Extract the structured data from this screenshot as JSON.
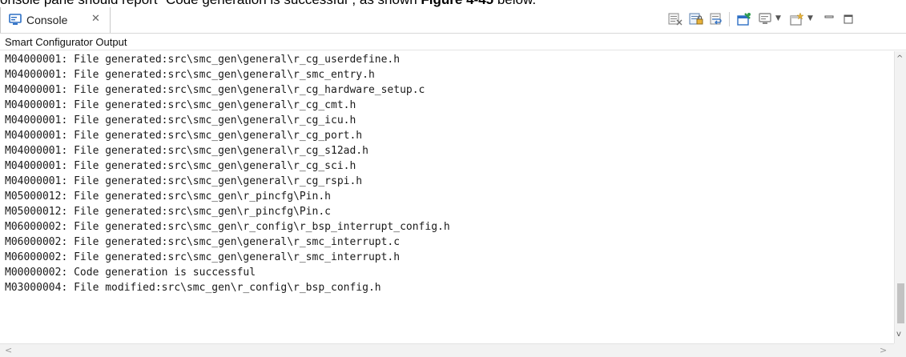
{
  "caption": {
    "prefix": "onsole pane should report “Code generation is successful”, as shown ",
    "figure_ref": "Figure 4-45",
    "suffix": " below."
  },
  "tab": {
    "label": "Console",
    "close_glyph": "✕",
    "icon": "console-icon"
  },
  "toolbar": {
    "icons": [
      "clear-console-icon",
      "scroll-lock-icon",
      "word-wrap-icon",
      "pin-console-icon",
      "display-console-icon",
      "open-console-icon",
      "minimize-icon",
      "maximize-icon"
    ]
  },
  "console": {
    "title": "Smart Configurator Output",
    "lines": [
      "M04000001: File generated:src\\smc_gen\\general\\r_cg_userdefine.h",
      "M04000001: File generated:src\\smc_gen\\general\\r_smc_entry.h",
      "M04000001: File generated:src\\smc_gen\\general\\r_cg_hardware_setup.c",
      "M04000001: File generated:src\\smc_gen\\general\\r_cg_cmt.h",
      "M04000001: File generated:src\\smc_gen\\general\\r_cg_icu.h",
      "M04000001: File generated:src\\smc_gen\\general\\r_cg_port.h",
      "M04000001: File generated:src\\smc_gen\\general\\r_cg_s12ad.h",
      "M04000001: File generated:src\\smc_gen\\general\\r_cg_sci.h",
      "M04000001: File generated:src\\smc_gen\\general\\r_cg_rspi.h",
      "M05000012: File generated:src\\smc_gen\\r_pincfg\\Pin.h",
      "M05000012: File generated:src\\smc_gen\\r_pincfg\\Pin.c",
      "M06000002: File generated:src\\smc_gen\\r_config\\r_bsp_interrupt_config.h",
      "M06000002: File generated:src\\smc_gen\\general\\r_smc_interrupt.c",
      "M06000002: File generated:src\\smc_gen\\general\\r_smc_interrupt.h",
      "M00000002: Code generation is successful",
      "M03000004: File modified:src\\smc_gen\\r_config\\r_bsp_config.h"
    ]
  },
  "colors": {
    "accent_blue": "#2d6fc4",
    "pin_green": "#2e9b4e",
    "folder_yellow": "#e8b23a"
  }
}
